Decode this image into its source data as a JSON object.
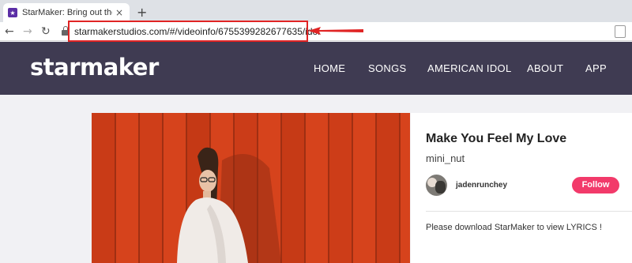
{
  "browser": {
    "tab_title": "StarMaker: Bring out the singer",
    "tab_close_glyph": "×",
    "new_tab_glyph": "+",
    "back_glyph": "←",
    "forward_glyph": "→",
    "reload_glyph": "↻",
    "url": "starmakerstudios.com/#/videoinfo/6755399282677635/idol",
    "favicon_glyph": "★",
    "highlight_color": "#e02424"
  },
  "site": {
    "logo": "starmaker",
    "nav": [
      "HOME",
      "SONGS",
      "AMERICAN IDOL",
      "ABOUT",
      "APP"
    ],
    "header_color": "#3f3b52"
  },
  "song": {
    "title": "Make You Feel My Love",
    "singer": "mini_nut",
    "user": "jadenrunchey",
    "follow_label": "Follow",
    "follow_color": "#f23a6a",
    "lyrics_message": "Please download StarMaker to view LYRICS !"
  }
}
